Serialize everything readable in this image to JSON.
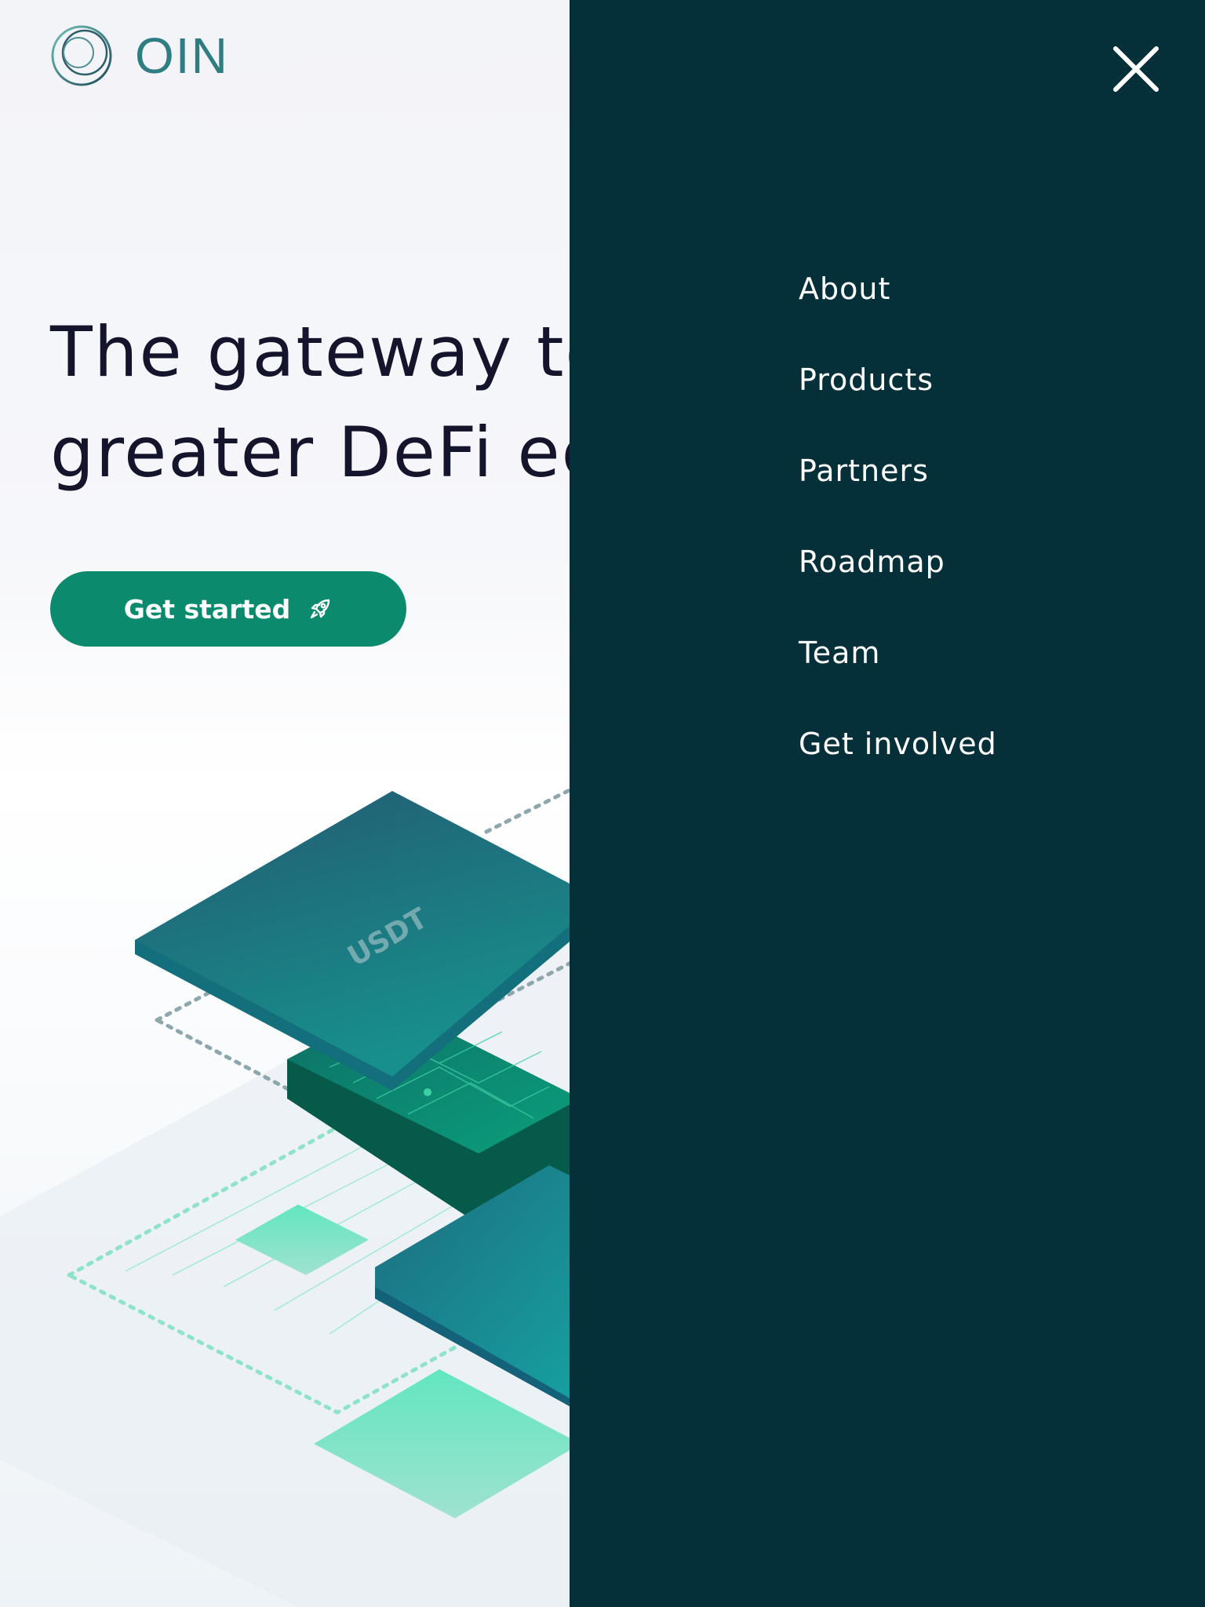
{
  "brand": {
    "name": "OIN",
    "logo_icon": "concentric-rings-logo"
  },
  "hero": {
    "title_line1": "The gateway to the",
    "title_line2": "greater DeFi ecosystem",
    "cta_label": "Get started",
    "cta_icon": "rocket-icon"
  },
  "illustration": {
    "card_label": "USDT"
  },
  "menu": {
    "close_icon": "close-icon",
    "items": [
      {
        "label": "About"
      },
      {
        "label": "Products"
      },
      {
        "label": "Partners"
      },
      {
        "label": "Roadmap"
      },
      {
        "label": "Team"
      },
      {
        "label": "Get involved"
      }
    ]
  },
  "colors": {
    "drawer_bg": "#05303a",
    "cta_bg": "#0b8a6d",
    "title_text": "#15142d",
    "brand_teal": "#2d7d83"
  }
}
